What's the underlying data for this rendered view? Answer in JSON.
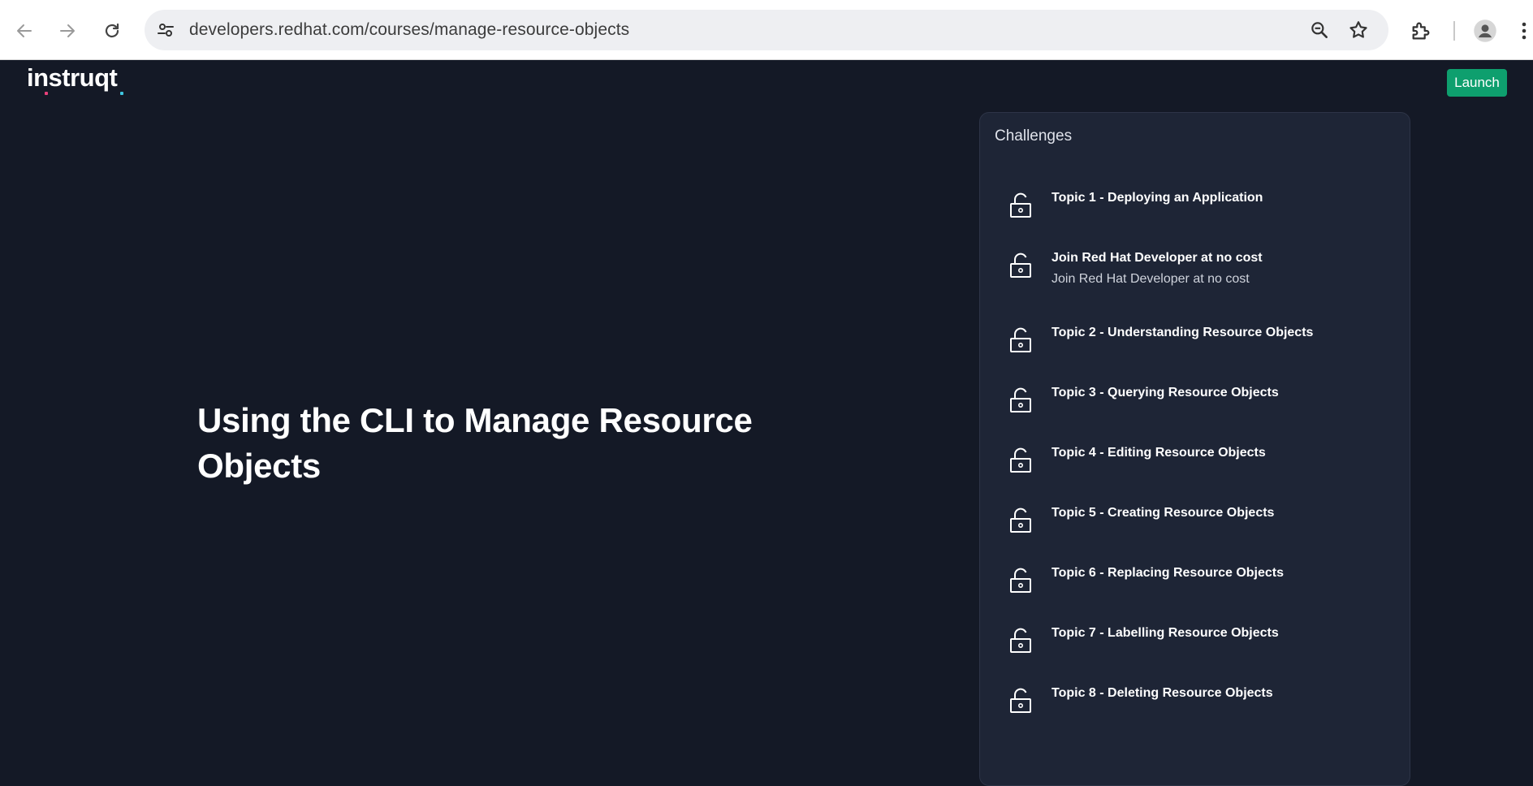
{
  "browser": {
    "url": "developers.redhat.com/courses/manage-resource-objects"
  },
  "header": {
    "logo_text": "instruqt",
    "launch_label": "Launch"
  },
  "hero": {
    "title": "Using the CLI to Manage Resource Objects"
  },
  "challenges": {
    "heading": "Challenges",
    "items": [
      {
        "title": "Topic 1 - Deploying an Application",
        "subtitle": ""
      },
      {
        "title": "Join Red Hat Developer at no cost",
        "subtitle": "Join Red Hat Developer at no cost"
      },
      {
        "title": "Topic 2 - Understanding Resource Objects",
        "subtitle": ""
      },
      {
        "title": "Topic 3 - Querying Resource Objects",
        "subtitle": ""
      },
      {
        "title": "Topic 4 - Editing Resource Objects",
        "subtitle": ""
      },
      {
        "title": "Topic 5 - Creating Resource Objects",
        "subtitle": ""
      },
      {
        "title": "Topic 6 - Replacing Resource Objects",
        "subtitle": ""
      },
      {
        "title": "Topic 7 - Labelling Resource Objects",
        "subtitle": ""
      },
      {
        "title": "Topic 8 - Deleting Resource Objects",
        "subtitle": ""
      }
    ]
  },
  "colors": {
    "page_bg": "#141926",
    "panel_bg": "#1e2536",
    "launch_green": "#0e9f6e"
  }
}
